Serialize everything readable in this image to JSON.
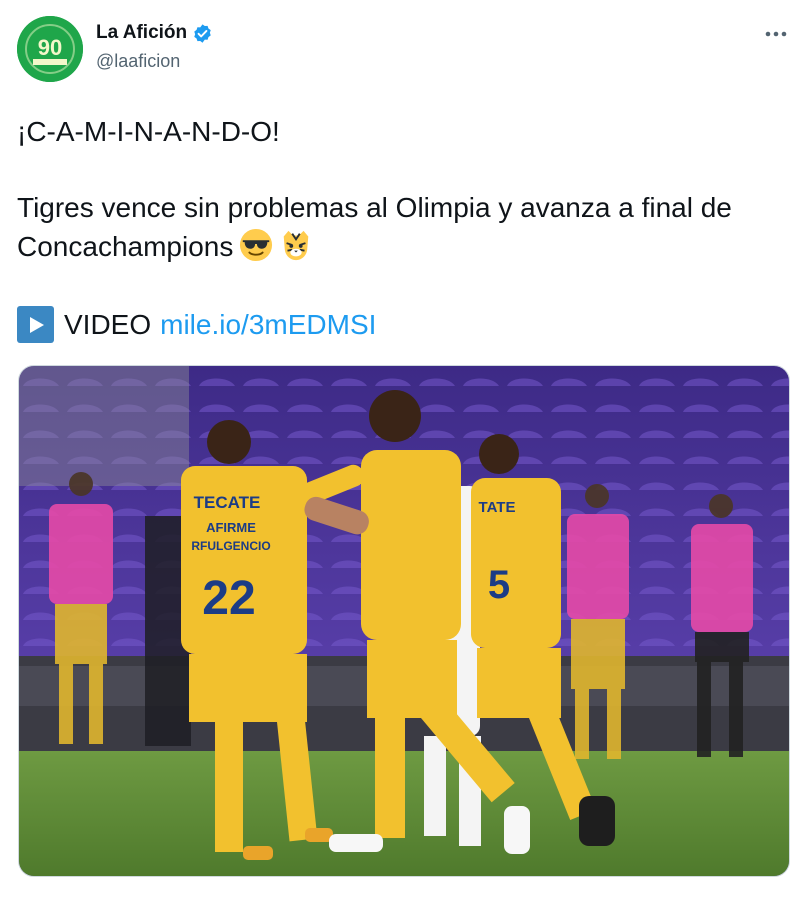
{
  "account": {
    "display_name": "La Afición",
    "handle": "@laaficion",
    "avatar_text": "90",
    "verified": true
  },
  "tweet": {
    "line1": "¡C-A-M-I-N-A-N-D-O!",
    "line2": "Tigres vence sin problemas al Olimpia y avanza a final de Concachampions",
    "emojis": [
      "smiling-face-with-sunglasses",
      "tiger-face"
    ],
    "video_label": "VIDEO",
    "link_text": "mile.io/3mEDMSI"
  },
  "media": {
    "jersey_sponsor": "TECATE",
    "jersey_number": "22",
    "jersey_name": "AFIRME",
    "jersey_surname": "RFULGENCIO",
    "second_number": "5",
    "second_sponsor": "TATE"
  },
  "colors": {
    "brand_green": "#1fa64a",
    "verified_blue": "#1d9bf0",
    "link_blue": "#1d9bf0",
    "jersey_yellow": "#f2c12e",
    "stadium_purple": "#5b3fa8",
    "pitch_green": "#5c8a35"
  }
}
